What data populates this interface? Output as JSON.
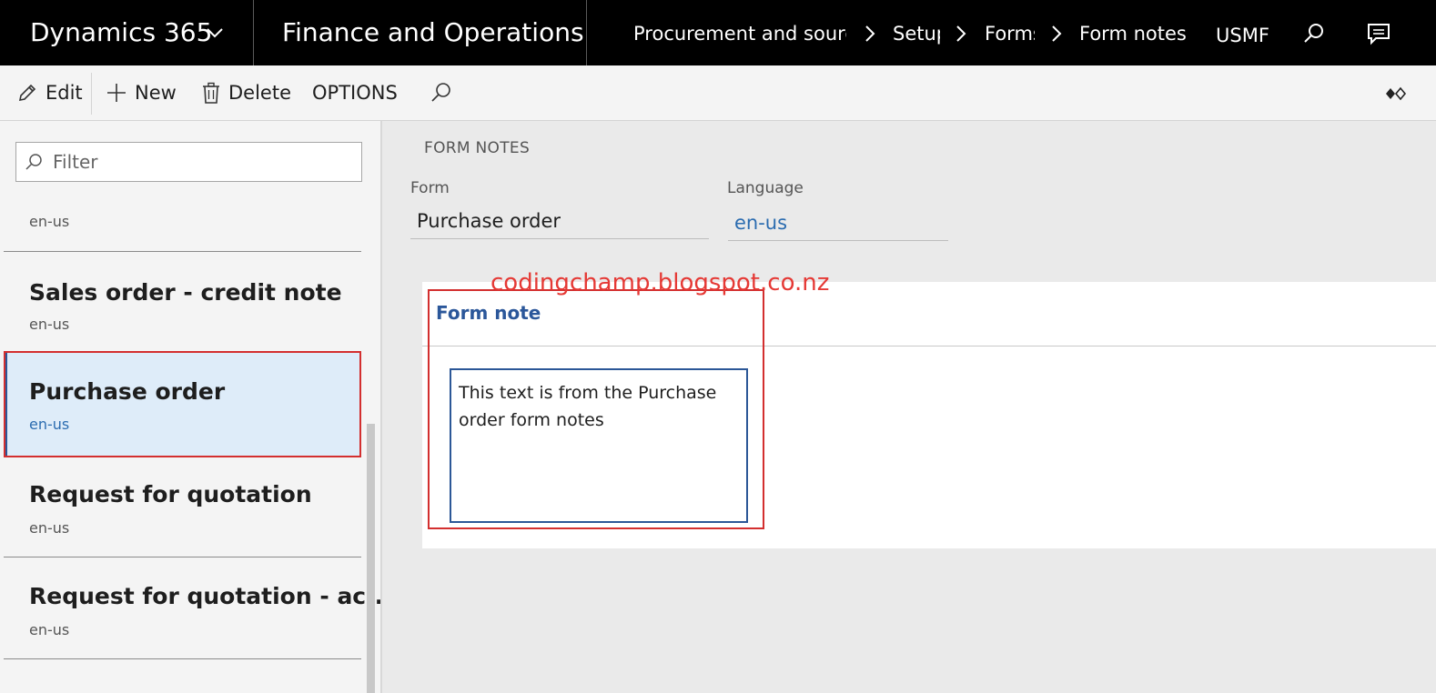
{
  "nav": {
    "brand": "Dynamics 365",
    "app": "Finance and Operations",
    "breadcrumbs": [
      "Procurement and sourcing",
      "Setup",
      "Forms",
      "Form notes"
    ],
    "company": "USMF",
    "icons": [
      "chevron-down-icon",
      "search-icon",
      "message-icon"
    ]
  },
  "actions": {
    "edit": "Edit",
    "new": "New",
    "delete": "Delete",
    "options": "OPTIONS"
  },
  "list": {
    "filter_placeholder": "Filter",
    "items": [
      {
        "title": "",
        "sub": "en-us"
      },
      {
        "title": "Sales order - credit note",
        "sub": "en-us"
      },
      {
        "title": "Purchase order",
        "sub": "en-us",
        "selected": true
      },
      {
        "title": "Request for quotation",
        "sub": "en-us"
      },
      {
        "title": "Request for quotation - ac...",
        "sub": "en-us"
      }
    ]
  },
  "detail": {
    "section": "FORM NOTES",
    "form_label": "Form",
    "form_value": "Purchase order",
    "language_label": "Language",
    "language_value": "en-us",
    "card_title": "Form note",
    "note_text": "This text is from the Purchase order form notes"
  },
  "watermark": "codingchamp.blogspot.co.nz",
  "colors": {
    "nav_bg": "#000000",
    "accent": "#2b579a",
    "highlight": "#d32f2f",
    "selected_bg": "#deecf9"
  }
}
